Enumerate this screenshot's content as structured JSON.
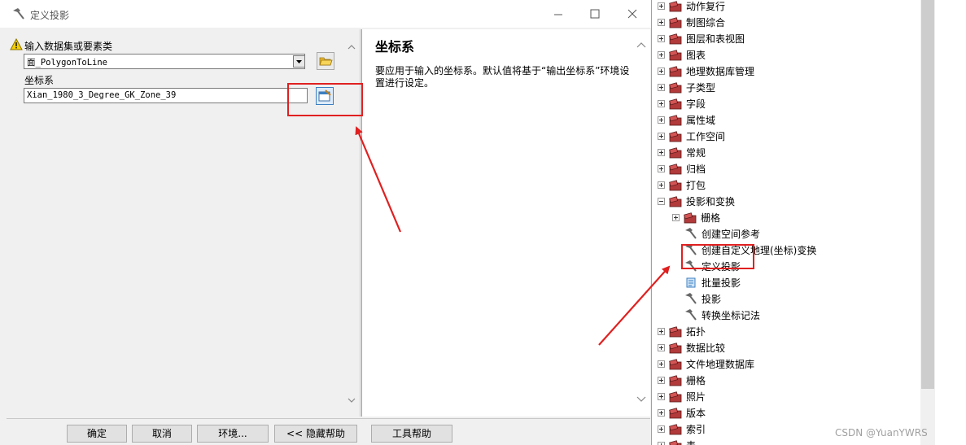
{
  "dialog": {
    "title": "定义投影",
    "fields": {
      "input_label": "输入数据集或要素类",
      "input_value": "面_PolygonToLine",
      "coord_label": "坐标系",
      "coord_value": "Xian_1980_3_Degree_GK_Zone_39"
    },
    "help": {
      "title": "坐标系",
      "text": "要应用于输入的坐标系。默认值将基于“输出坐标系”环境设置进行设定。"
    },
    "buttons": {
      "ok": "确定",
      "cancel": "取消",
      "environments": "环境...",
      "hide_help": "<< 隐藏帮助",
      "tool_help": "工具帮助"
    }
  },
  "toolbox": {
    "items": [
      {
        "label": "动作复行",
        "kind": "toolbox",
        "level": 0,
        "expander": "plus"
      },
      {
        "label": "制图综合",
        "kind": "toolbox",
        "level": 0,
        "expander": "plus"
      },
      {
        "label": "图层和表视图",
        "kind": "toolbox",
        "level": 0,
        "expander": "plus"
      },
      {
        "label": "图表",
        "kind": "toolbox",
        "level": 0,
        "expander": "plus"
      },
      {
        "label": "地理数据库管理",
        "kind": "toolbox",
        "level": 0,
        "expander": "plus"
      },
      {
        "label": "子类型",
        "kind": "toolbox",
        "level": 0,
        "expander": "plus"
      },
      {
        "label": "字段",
        "kind": "toolbox",
        "level": 0,
        "expander": "plus"
      },
      {
        "label": "属性域",
        "kind": "toolbox",
        "level": 0,
        "expander": "plus"
      },
      {
        "label": "工作空间",
        "kind": "toolbox",
        "level": 0,
        "expander": "plus"
      },
      {
        "label": "常规",
        "kind": "toolbox",
        "level": 0,
        "expander": "plus"
      },
      {
        "label": "归档",
        "kind": "toolbox",
        "level": 0,
        "expander": "plus"
      },
      {
        "label": "打包",
        "kind": "toolbox",
        "level": 0,
        "expander": "plus"
      },
      {
        "label": "投影和变换",
        "kind": "toolbox",
        "level": 0,
        "expander": "minus"
      },
      {
        "label": "栅格",
        "kind": "toolbox",
        "level": 1,
        "expander": "plus"
      },
      {
        "label": "创建空间参考",
        "kind": "tool",
        "level": 1
      },
      {
        "label": "创建自定义地理(坐标)变换",
        "kind": "tool",
        "level": 1
      },
      {
        "label": "定义投影",
        "kind": "tool",
        "level": 1
      },
      {
        "label": "批量投影",
        "kind": "script",
        "level": 1
      },
      {
        "label": "投影",
        "kind": "tool",
        "level": 1
      },
      {
        "label": "转换坐标记法",
        "kind": "tool",
        "level": 1
      },
      {
        "label": "拓扑",
        "kind": "toolbox",
        "level": 0,
        "expander": "plus"
      },
      {
        "label": "数据比较",
        "kind": "toolbox",
        "level": 0,
        "expander": "plus"
      },
      {
        "label": "文件地理数据库",
        "kind": "toolbox",
        "level": 0,
        "expander": "plus"
      },
      {
        "label": "栅格",
        "kind": "toolbox",
        "level": 0,
        "expander": "plus"
      },
      {
        "label": "照片",
        "kind": "toolbox",
        "level": 0,
        "expander": "plus"
      },
      {
        "label": "版本",
        "kind": "toolbox",
        "level": 0,
        "expander": "plus"
      },
      {
        "label": "索引",
        "kind": "toolbox",
        "level": 0,
        "expander": "plus"
      },
      {
        "label": "表",
        "kind": "toolbox",
        "level": 0,
        "expander": "plus"
      }
    ]
  },
  "watermark": "CSDN @YuanYWRS",
  "colors": {
    "annotation": "#e02020",
    "dialog_bg": "#f0f0f0"
  }
}
